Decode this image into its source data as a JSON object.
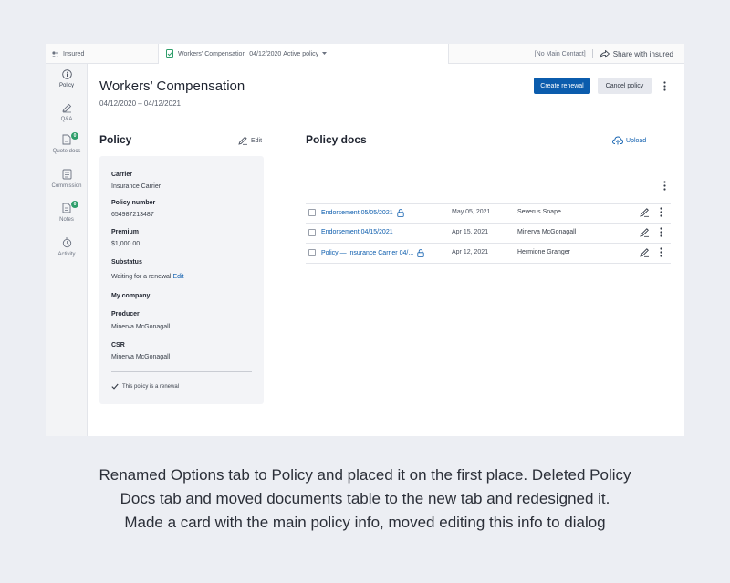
{
  "topbar": {
    "insured_label": "Insured",
    "policy_type": "Workers' Compensation",
    "policy_date": "04/12/2020",
    "policy_status": "Active policy",
    "contact": "[No Main Contact]",
    "share_label": "Share with insured"
  },
  "sidebar": {
    "items": [
      {
        "label": "Policy",
        "icon": "info-icon",
        "active": true
      },
      {
        "label": "Q&A",
        "icon": "qa-icon"
      },
      {
        "label": "Quote docs",
        "icon": "quote-docs-icon",
        "badge": "0"
      },
      {
        "label": "Commission",
        "icon": "commission-icon"
      },
      {
        "label": "Notes",
        "icon": "notes-icon",
        "badge": "0"
      },
      {
        "label": "Activity",
        "icon": "activity-icon"
      }
    ]
  },
  "header": {
    "title": "Workers’ Compensation",
    "dates": "04/12/2020 – 04/12/2021",
    "create_renewal": "Create renewal",
    "cancel_policy": "Cancel policy"
  },
  "policy": {
    "section_title": "Policy",
    "edit_label": "Edit",
    "carrier_label": "Carrier",
    "carrier_value": "Insurance Carrier",
    "number_label": "Policy number",
    "number_value": "654987213487",
    "premium_label": "Premium",
    "premium_value": "$1,000.00",
    "substatus_label": "Substatus",
    "substatus_value": "Waiting for a renewal",
    "substatus_edit": "Edit",
    "company_label": "My company",
    "producer_label": "Producer",
    "producer_value": "Minerva McGonagall",
    "csr_label": "CSR",
    "csr_value": "Minerva McGonagall",
    "renewal_note": "This policy is a renewal"
  },
  "docs": {
    "section_title": "Policy docs",
    "upload_label": "Upload",
    "rows": [
      {
        "name": "Endorsement 05/05/2021",
        "date": "May 05, 2021",
        "author": "Severus Snape"
      },
      {
        "name": "Endorsement 04/15/2021",
        "date": "Apr 15, 2021",
        "author": "Minerva McGonagall"
      },
      {
        "name": "Policy — Insurance Carrier 04/...",
        "date": "Apr 12, 2021",
        "author": "Hermione Granger"
      }
    ]
  },
  "caption": {
    "line1": "Renamed Options tab to Policy and placed it on the first place. Deleted Policy",
    "line2": "Docs tab and moved documents table to the new tab and redesigned it.",
    "line3": "Made a card with the main policy info, moved editing this info to dialog"
  },
  "colors": {
    "accent": "#0b5cad",
    "badge": "#2f9e6b",
    "page_background": "#eceef3"
  }
}
